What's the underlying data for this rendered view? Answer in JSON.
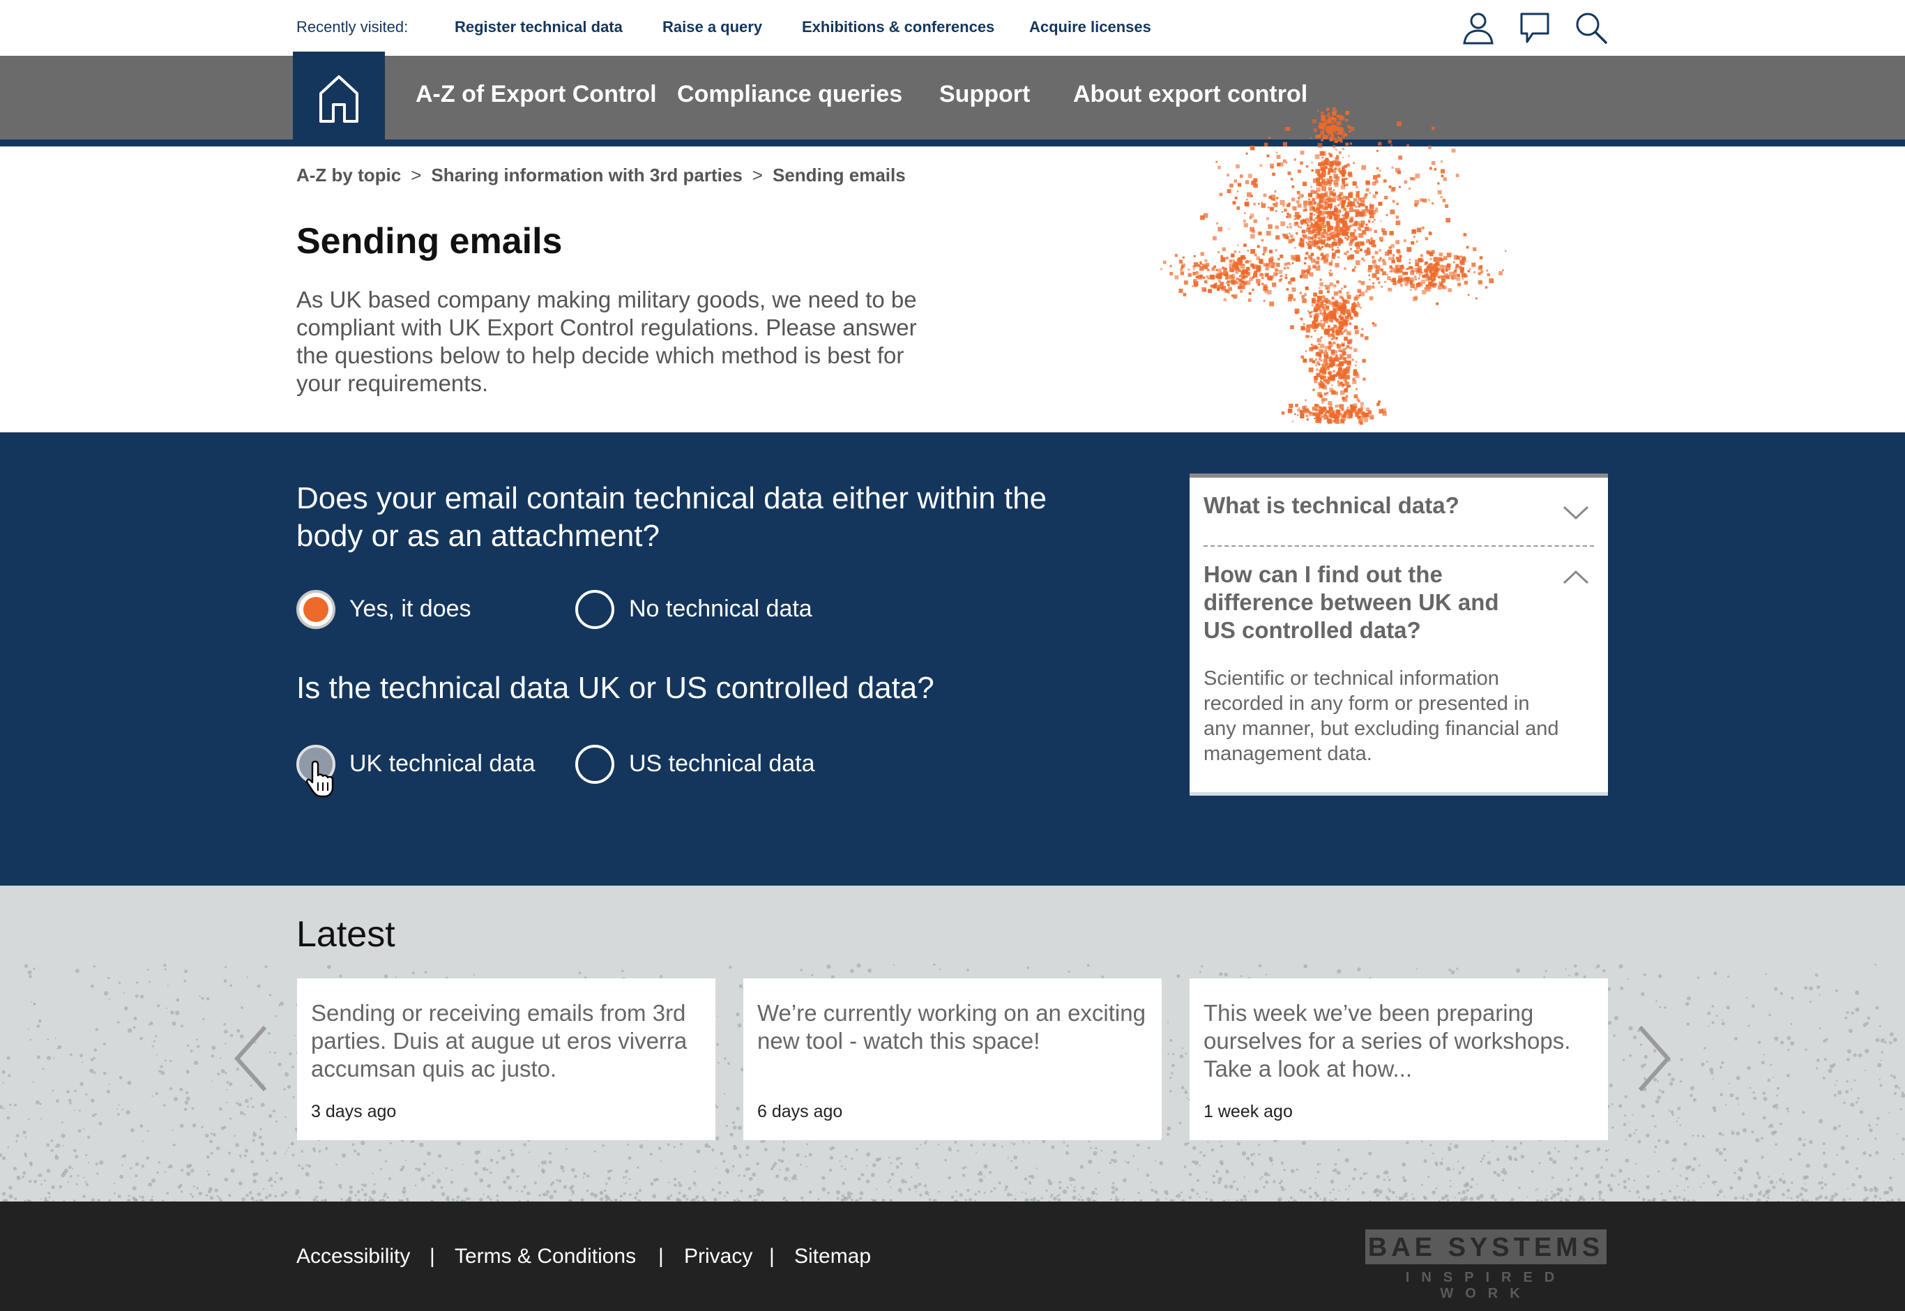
{
  "topbar": {
    "recently_visited_label": "Recently visited:",
    "links": [
      "Register technical data",
      "Raise a query",
      "Exhibitions & conferences",
      "Acquire licenses"
    ],
    "icons": [
      "user-icon",
      "chat-icon",
      "search-icon"
    ]
  },
  "nav": {
    "home_icon": "home-icon",
    "items": [
      "A-Z of Export Control",
      "Compliance queries",
      "Support",
      "About export control"
    ]
  },
  "breadcrumb": {
    "items": [
      "A-Z by topic",
      "Sharing information with 3rd parties",
      "Sending emails"
    ],
    "separator": ">"
  },
  "hero": {
    "title": "Sending emails",
    "intro": "As UK based company making military goods, we need to be compliant with UK Export Control regulations. Please answer the questions below to help decide which method is best for your requirements."
  },
  "questions": [
    {
      "text": "Does your email contain technical data either within the body or as an attachment?",
      "options": [
        {
          "label": "Yes, it does",
          "state": "selected"
        },
        {
          "label": "No technical data",
          "state": "unselected"
        }
      ]
    },
    {
      "text": "Is the technical data UK or US controlled data?",
      "options": [
        {
          "label": "UK technical data",
          "state": "hover"
        },
        {
          "label": "US technical data",
          "state": "unselected"
        }
      ]
    }
  ],
  "accordion": {
    "items": [
      {
        "title": "What is technical data?",
        "expanded": false
      },
      {
        "title": "How can I find out the difference between UK and US controlled data?",
        "expanded": true,
        "body": "Scientific or technical information recorded in any form or presented in any manner, but excluding financial and management data."
      }
    ]
  },
  "latest": {
    "title": "Latest",
    "cards": [
      {
        "text": "Sending or receiving emails from 3rd parties. Duis at augue ut eros viverra accumsan quis ac justo.",
        "date": "3 days ago"
      },
      {
        "text": "We’re currently working on an exciting new tool - watch this space!",
        "date": "6 days ago"
      },
      {
        "text": "This week we’ve been preparing ourselves for a series of workshops. Take a look at how...",
        "date": "1 week ago"
      }
    ]
  },
  "footer": {
    "links": [
      "Accessibility",
      "Terms & Conditions",
      "Privacy",
      "Sitemap"
    ],
    "separator": "|",
    "logo_main": "BAE SYSTEMS",
    "logo_sub": "INSPIRED WORK"
  },
  "colors": {
    "navy": "#14365d",
    "nav_grey": "#6b6b6b",
    "accent_orange": "#ee6a2b",
    "latest_bg": "#d5d9da",
    "footer_bg": "#222222"
  }
}
